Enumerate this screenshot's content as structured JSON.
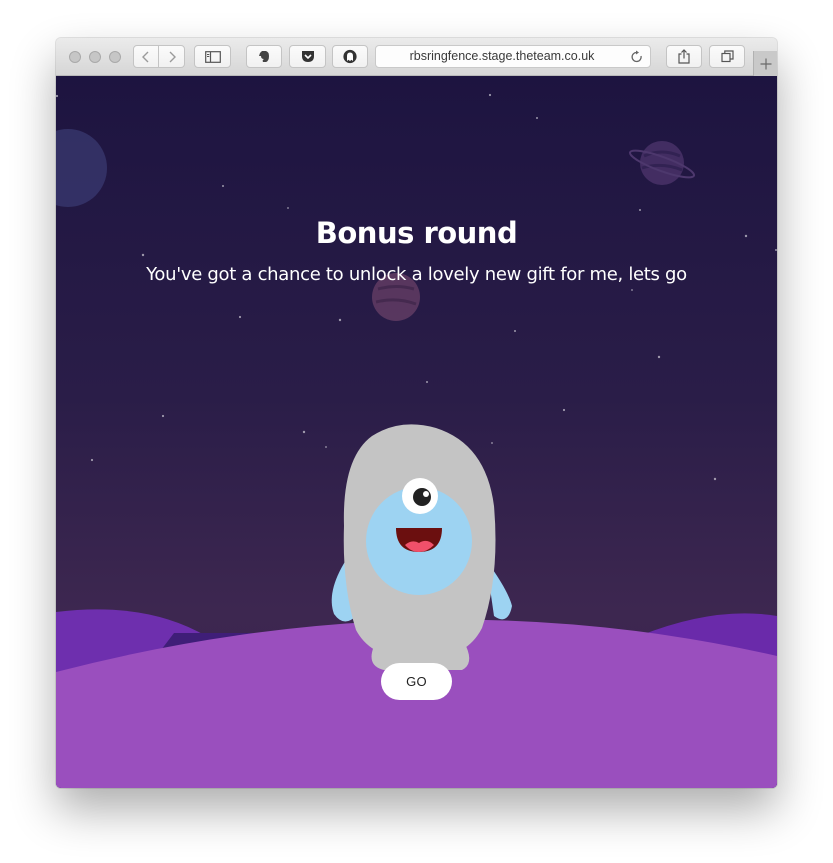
{
  "browser": {
    "url": "rbsringfence.stage.theteam.co.uk",
    "buttons": [
      "back",
      "forward",
      "sidebar",
      "evernote",
      "pocket",
      "ghostery",
      "share",
      "tabs",
      "new-tab"
    ]
  },
  "game": {
    "title": "Bonus round",
    "subtitle": "You've got a chance to unlock a lovely new gift for me, lets go",
    "go_label": "GO"
  },
  "colors": {
    "sky_top": "#1d1440",
    "sky_bottom": "#3d2750",
    "hill_front": "#9b50bf",
    "hill_back": "#6b30a8",
    "monster_body": "#c4c4c4",
    "monster_face": "#9dd3f2"
  }
}
